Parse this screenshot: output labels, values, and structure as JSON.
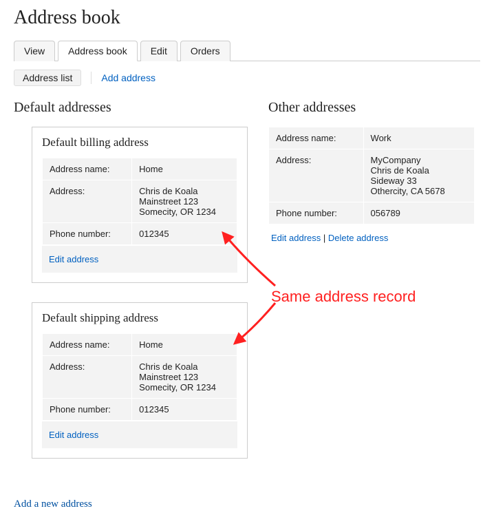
{
  "page_title": "Address book",
  "tabs": {
    "view": "View",
    "address_book": "Address book",
    "edit": "Edit",
    "orders": "Orders"
  },
  "subtabs": {
    "list": "Address list",
    "add": "Add address"
  },
  "sections": {
    "default_title": "Default addresses",
    "other_title": "Other addresses"
  },
  "labels": {
    "address_name": "Address name:",
    "address": "Address:",
    "phone": "Phone number:",
    "edit": "Edit address",
    "delete": "Delete address"
  },
  "billing": {
    "title": "Default billing address",
    "name": "Home",
    "line1": "Chris de Koala",
    "line2": "Mainstreet 123",
    "line3": "Somecity, OR 1234",
    "phone": "012345"
  },
  "shipping": {
    "title": "Default shipping address",
    "name": "Home",
    "line1": "Chris de Koala",
    "line2": "Mainstreet 123",
    "line3": "Somecity, OR 1234",
    "phone": "012345"
  },
  "other": {
    "name": "Work",
    "line1": "MyCompany",
    "line2": "Chris de Koala",
    "line3": "Sideway 33",
    "line4": "Othercity, CA 5678",
    "phone": "056789"
  },
  "add_new": "Add a new address",
  "annotation": "Same address record",
  "sep": " | "
}
